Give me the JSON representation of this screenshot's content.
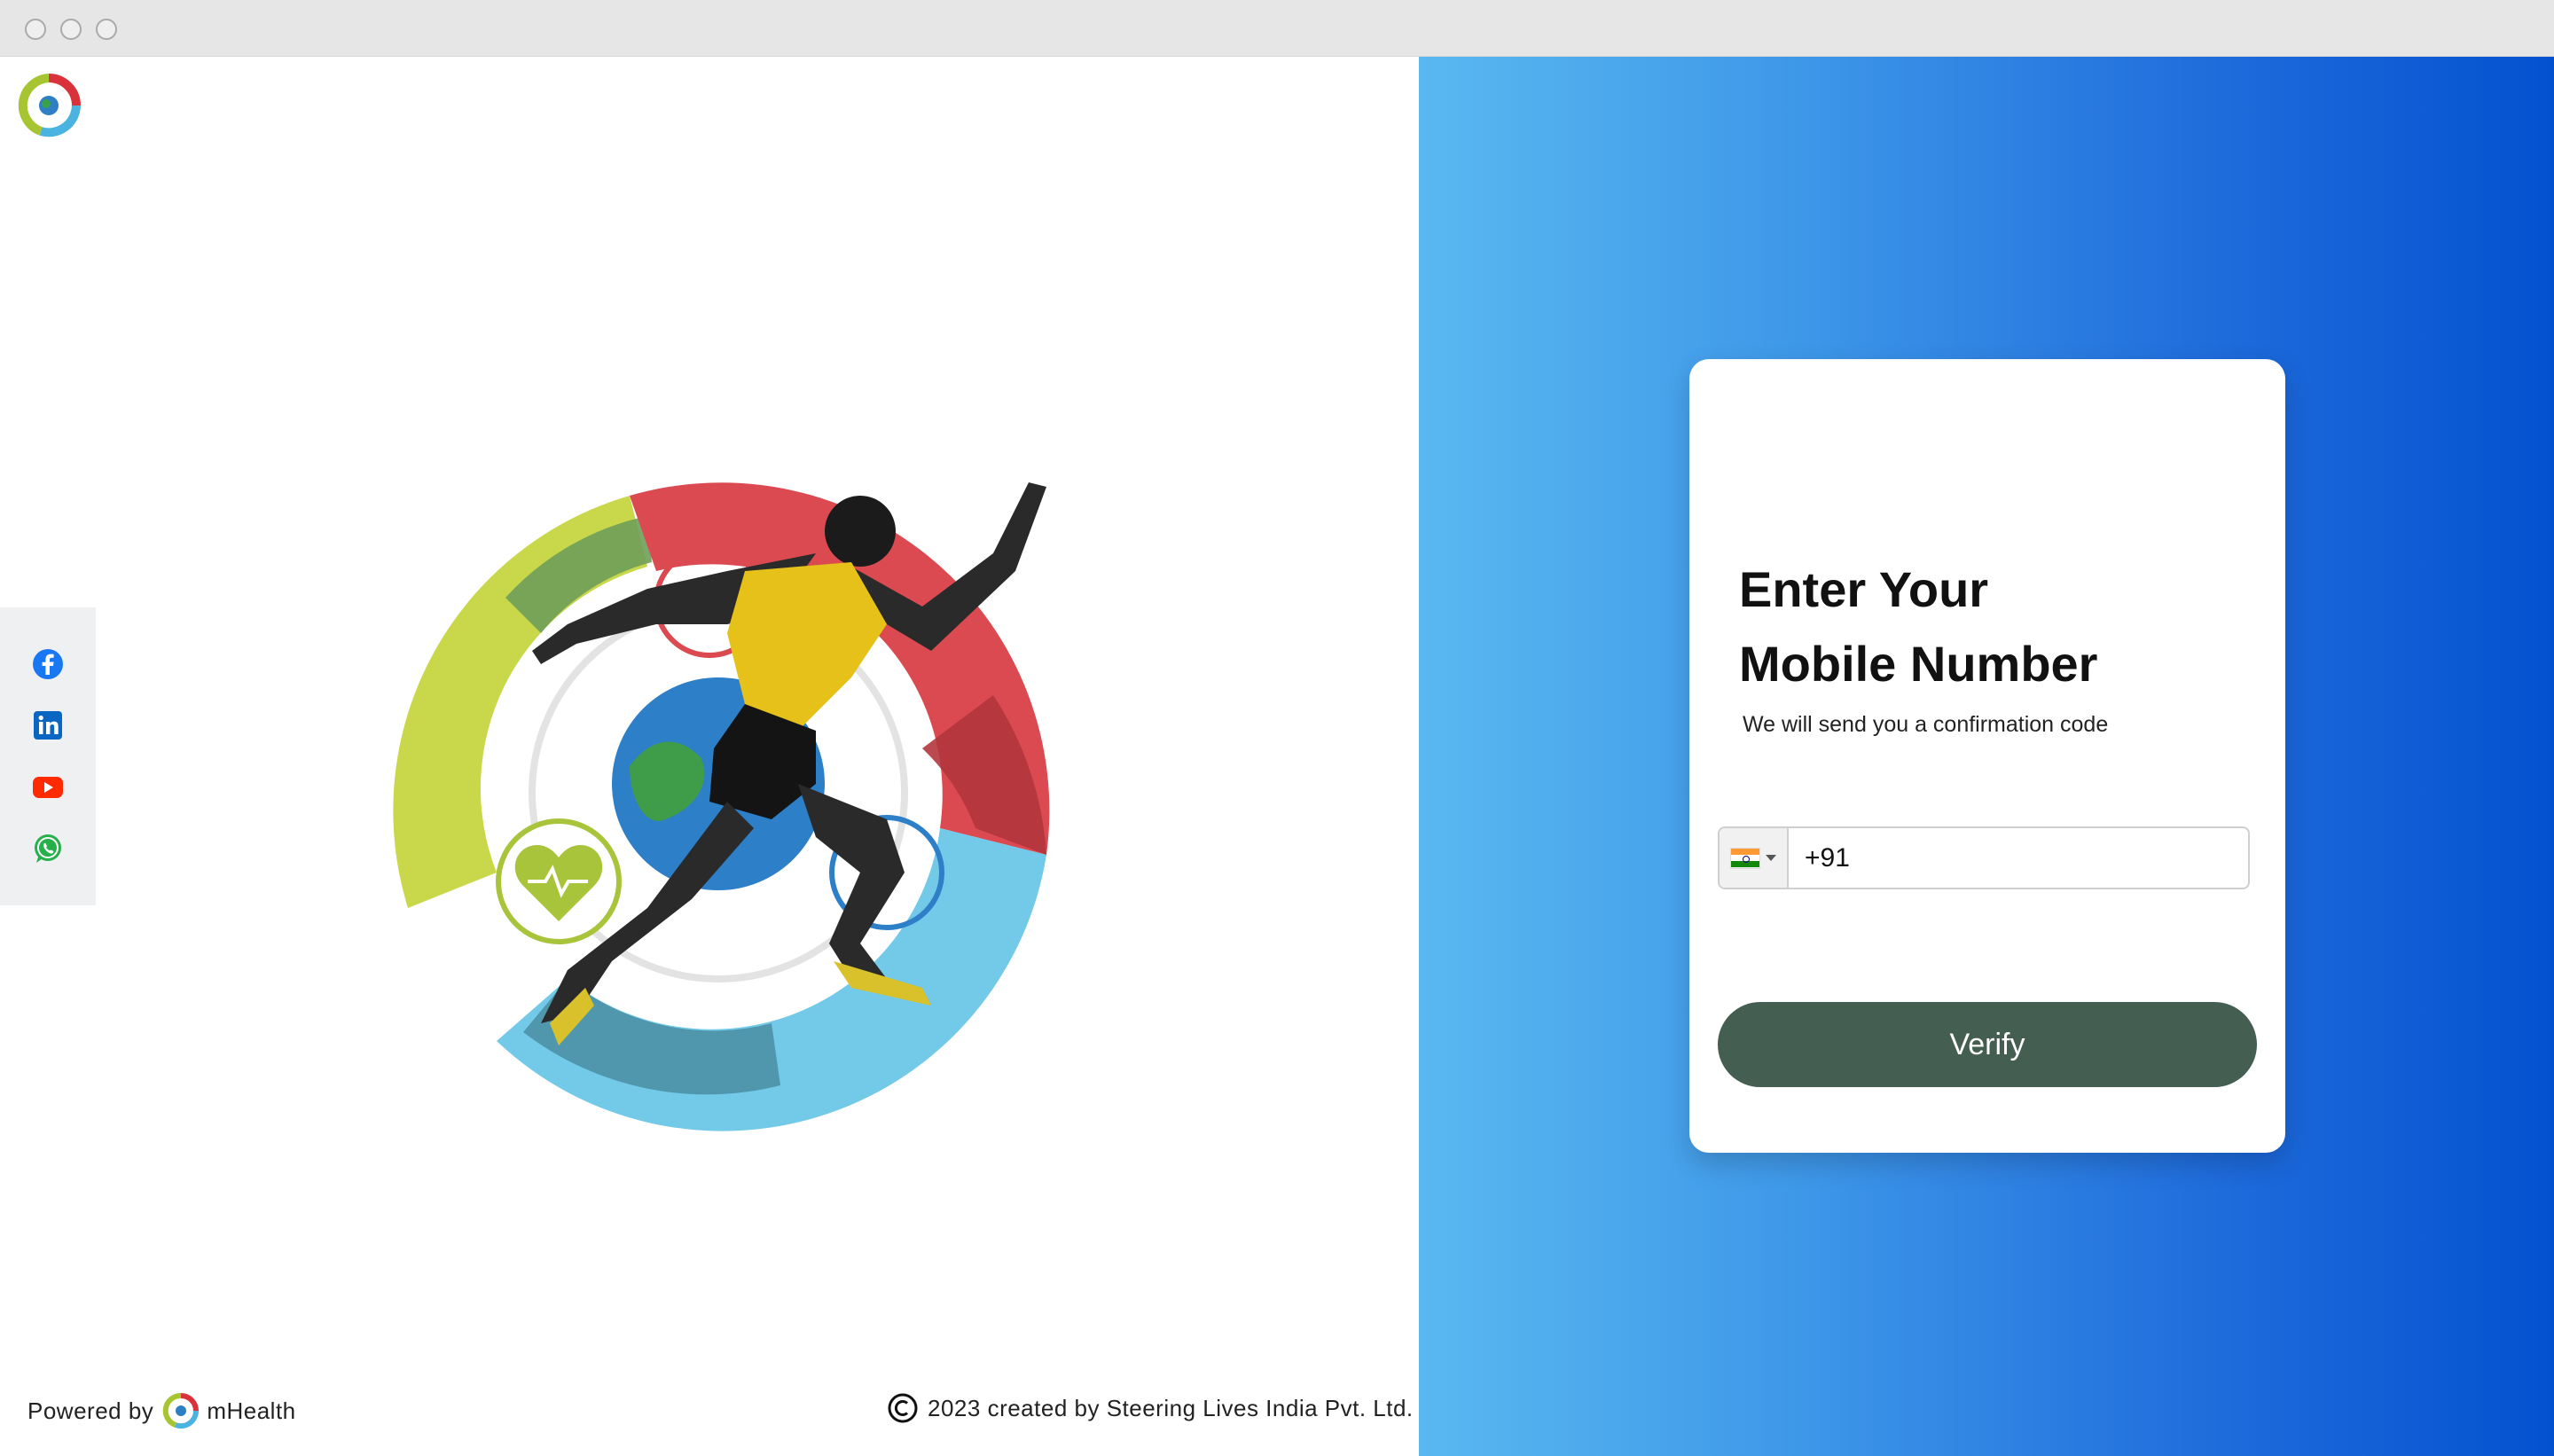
{
  "window": {
    "controls": [
      "close",
      "minimize",
      "maximize"
    ]
  },
  "brand": {
    "logo_icon": "mhealth-logo-icon",
    "name": "mHealth"
  },
  "social_links": [
    {
      "name": "facebook",
      "icon": "facebook-icon",
      "color": "#1877f2"
    },
    {
      "name": "linkedin",
      "icon": "linkedin-icon",
      "color": "#0a66c2"
    },
    {
      "name": "youtube",
      "icon": "youtube-icon",
      "color": "#ff2a00"
    },
    {
      "name": "whatsapp",
      "icon": "whatsapp-icon",
      "color": "#25b04a"
    }
  ],
  "hero": {
    "image": "runner-with-health-globe-illustration"
  },
  "footer": {
    "powered_by": "Powered by",
    "brand": "mHealth",
    "copyright": "2023 created by Steering Lives India Pvt. Ltd."
  },
  "login": {
    "title_line1": "Enter Your",
    "title_line2": "Mobile Number",
    "subtitle": "We will send you a confirmation code",
    "country_flag": "india-flag-icon",
    "phone_value": "+91",
    "verify_label": "Verify"
  },
  "colors": {
    "gradient_start": "#5ab8f0",
    "gradient_end": "#0451d0",
    "button": "#445e52",
    "card": "#ffffff"
  }
}
